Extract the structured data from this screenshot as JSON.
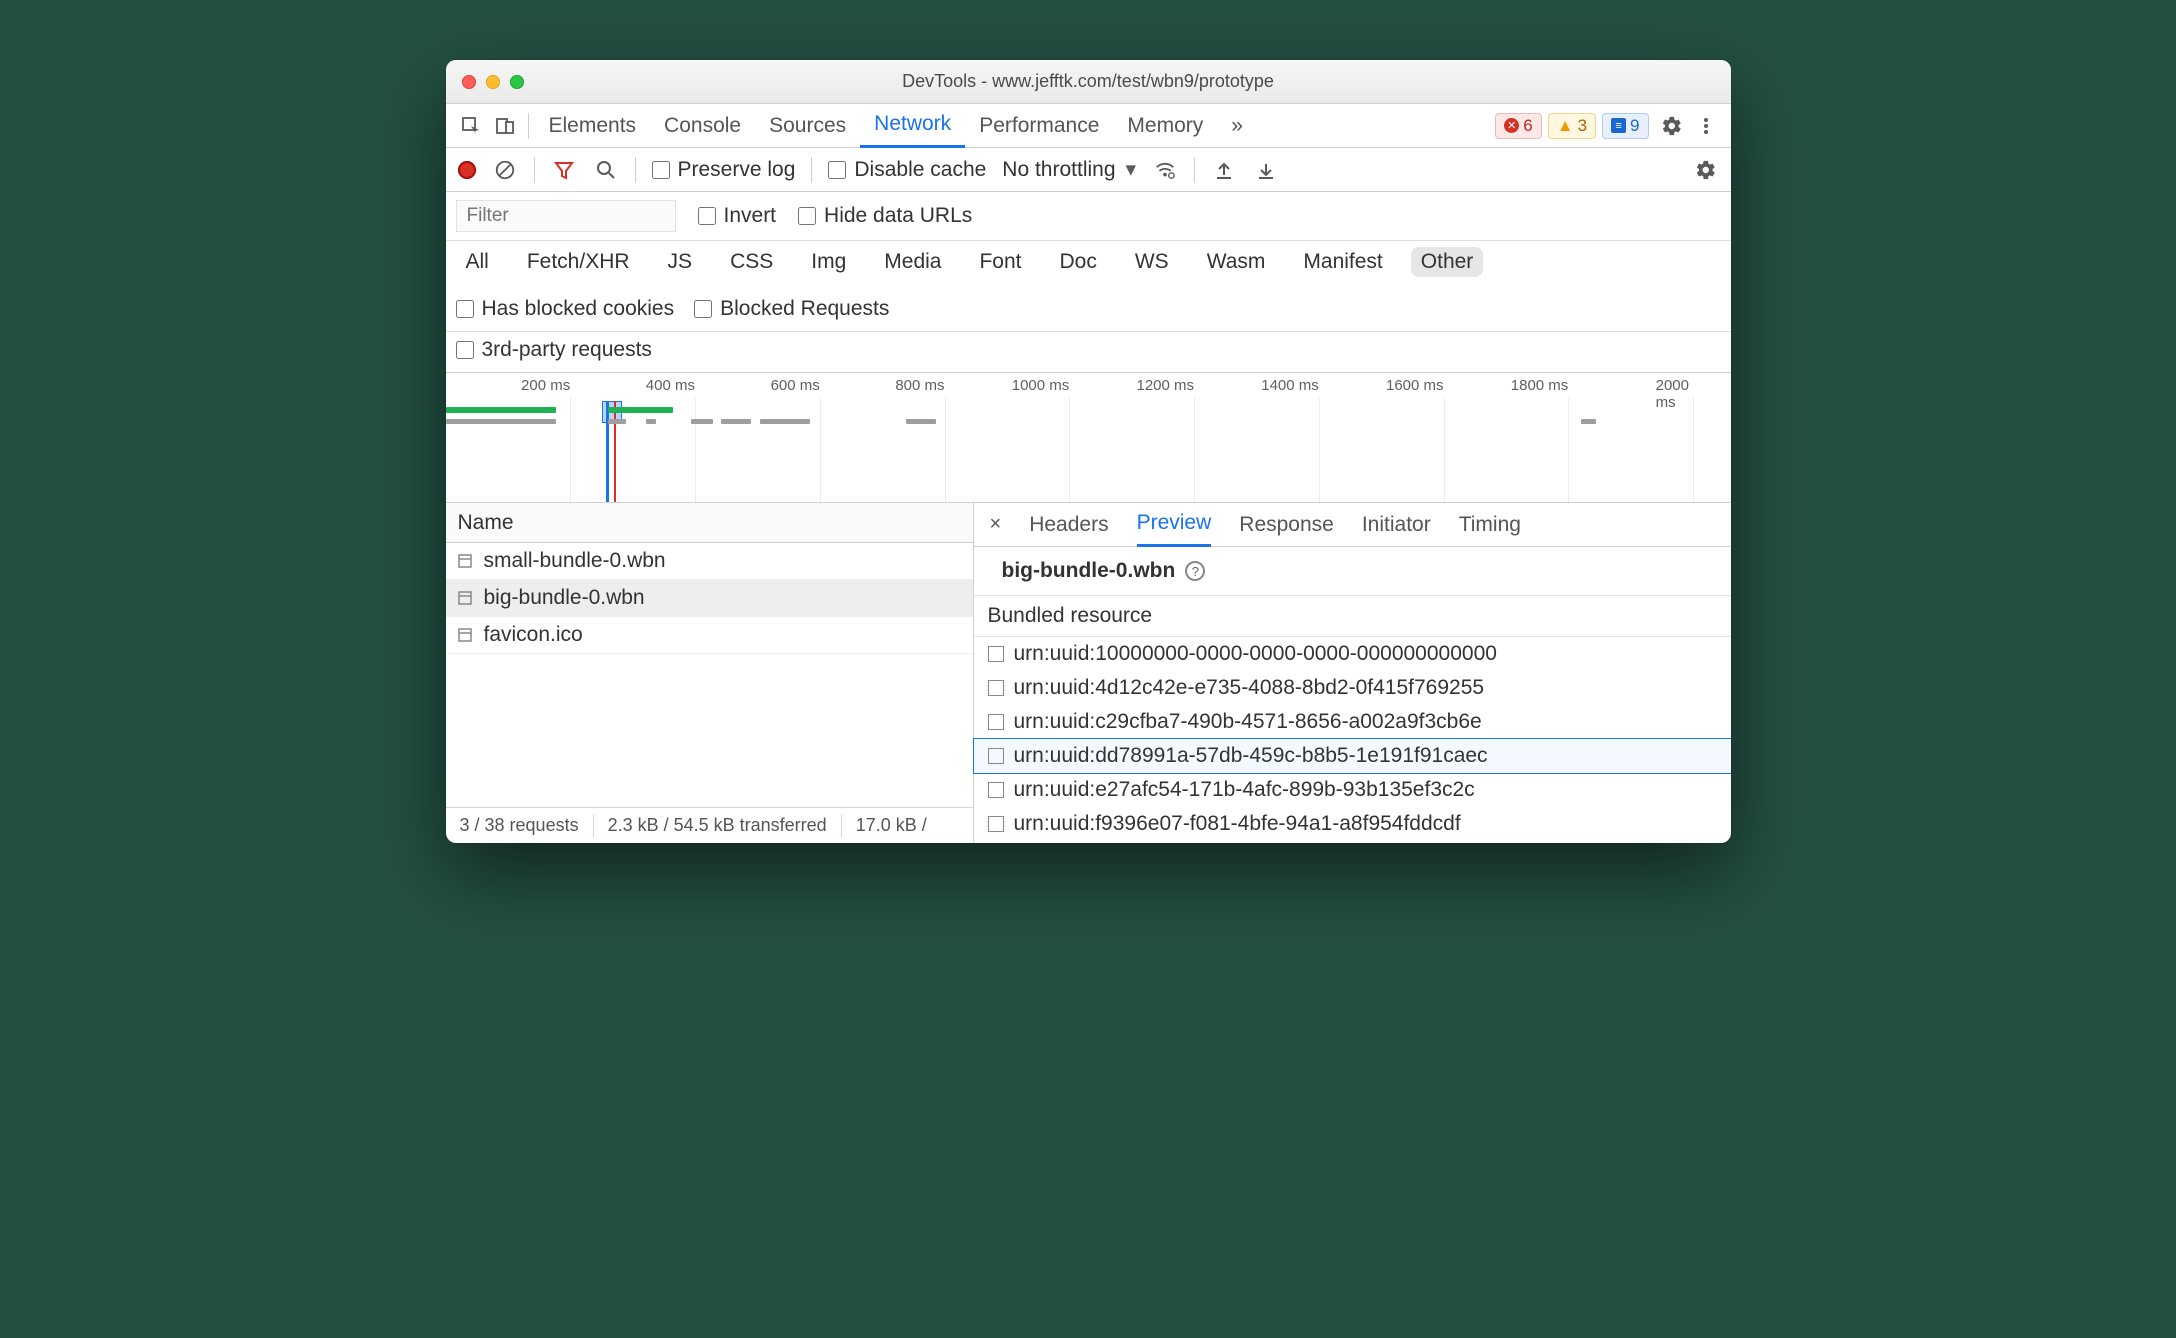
{
  "window": {
    "title": "DevTools - www.jefftk.com/test/wbn9/prototype"
  },
  "mainTabs": {
    "items": [
      "Elements",
      "Console",
      "Sources",
      "Network",
      "Performance",
      "Memory"
    ],
    "active": "Network",
    "more": "»"
  },
  "badges": {
    "errors": "6",
    "warnings": "3",
    "messages": "9"
  },
  "toolbar": {
    "preserve_log": "Preserve log",
    "disable_cache": "Disable cache",
    "throttling": "No throttling"
  },
  "filterBar": {
    "placeholder": "Filter",
    "invert": "Invert",
    "hide_data_urls": "Hide data URLs"
  },
  "typeFilters": {
    "items": [
      "All",
      "Fetch/XHR",
      "JS",
      "CSS",
      "Img",
      "Media",
      "Font",
      "Doc",
      "WS",
      "Wasm",
      "Manifest",
      "Other"
    ],
    "active": "Other",
    "has_blocked_cookies": "Has blocked cookies",
    "blocked_requests": "Blocked Requests"
  },
  "thirdParty": {
    "label": "3rd-party requests"
  },
  "timeline": {
    "ticks": [
      "200 ms",
      "400 ms",
      "600 ms",
      "800 ms",
      "1000 ms",
      "1200 ms",
      "1400 ms",
      "1600 ms",
      "1800 ms",
      "2000 ms"
    ]
  },
  "requests": {
    "column": "Name",
    "rows": [
      {
        "name": "small-bundle-0.wbn",
        "selected": false
      },
      {
        "name": "big-bundle-0.wbn",
        "selected": true
      },
      {
        "name": "favicon.ico",
        "selected": false
      }
    ]
  },
  "status": {
    "requests": "3 / 38 requests",
    "transferred": "2.3 kB / 54.5 kB transferred",
    "resources": "17.0 kB /"
  },
  "detailTabs": {
    "items": [
      "Headers",
      "Preview",
      "Response",
      "Initiator",
      "Timing"
    ],
    "active": "Preview"
  },
  "preview": {
    "filename": "big-bundle-0.wbn",
    "section": "Bundled resource",
    "resources": [
      "urn:uuid:10000000-0000-0000-0000-000000000000",
      "urn:uuid:4d12c42e-e735-4088-8bd2-0f415f769255",
      "urn:uuid:c29cfba7-490b-4571-8656-a002a9f3cb6e",
      "urn:uuid:dd78991a-57db-459c-b8b5-1e191f91caec",
      "urn:uuid:e27afc54-171b-4afc-899b-93b135ef3c2c",
      "urn:uuid:f9396e07-f081-4bfe-94a1-a8f954fddcdf"
    ],
    "highlight_index": 3
  }
}
